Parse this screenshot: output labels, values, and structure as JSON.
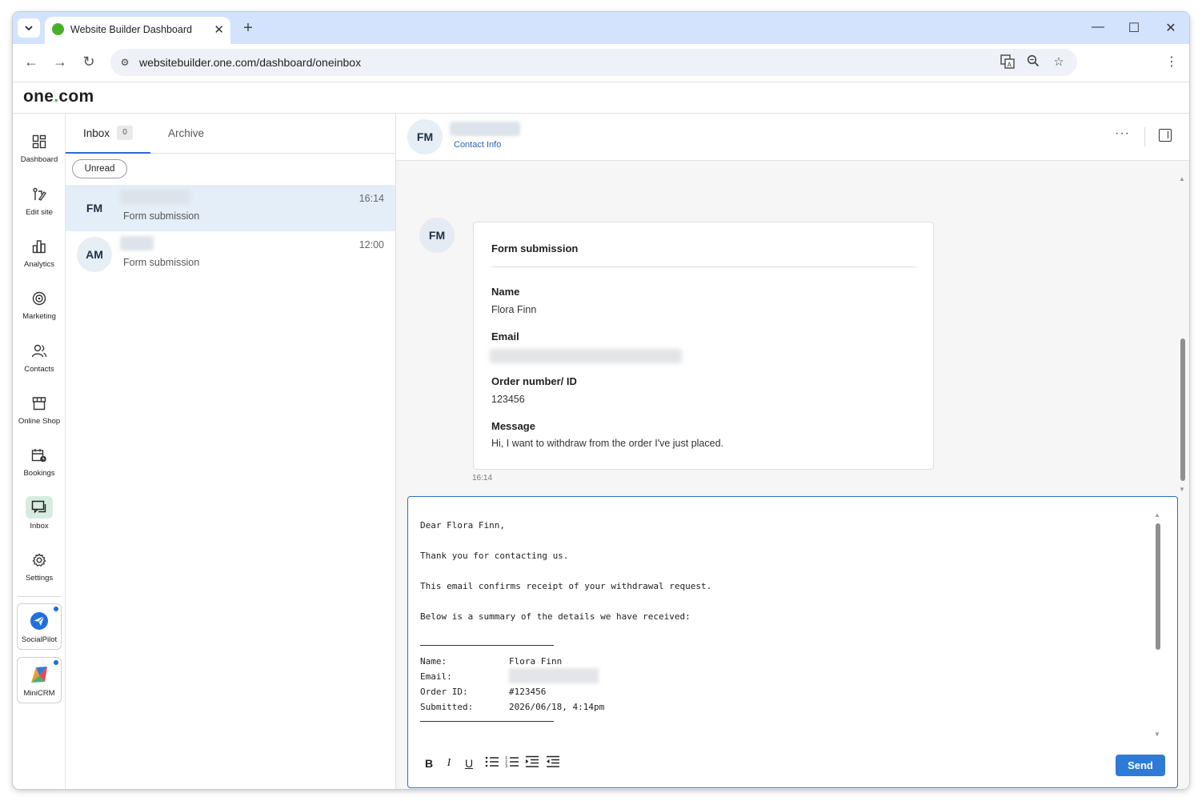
{
  "browser": {
    "tab_title": "Website Builder Dashboard",
    "url": "websitebuilder.one.com/dashboard/oneinbox"
  },
  "app": {
    "logo_text_a": "one",
    "logo_dot": ".",
    "logo_text_b": "com"
  },
  "nav": {
    "items": [
      {
        "label": "Dashboard",
        "icon": "dashboard-icon"
      },
      {
        "label": "Edit site",
        "icon": "edit-site-icon"
      },
      {
        "label": "Analytics",
        "icon": "analytics-icon"
      },
      {
        "label": "Marketing",
        "icon": "marketing-icon"
      },
      {
        "label": "Contacts",
        "icon": "contacts-icon"
      },
      {
        "label": "Online Shop",
        "icon": "shop-icon"
      },
      {
        "label": "Bookings",
        "icon": "bookings-icon"
      },
      {
        "label": "Inbox",
        "icon": "inbox-icon"
      },
      {
        "label": "Settings",
        "icon": "settings-icon"
      }
    ],
    "apps": [
      {
        "label": "SocialPilot",
        "icon": "socialpilot-icon"
      },
      {
        "label": "MiniCRM",
        "icon": "minicrm-icon"
      }
    ]
  },
  "inbox": {
    "tab_inbox": "Inbox",
    "inbox_count": "0",
    "tab_archive": "Archive",
    "filter_unread": "Unread",
    "conversations": [
      {
        "initials": "FM",
        "time": "16:14",
        "subject": "Form submission"
      },
      {
        "initials": "AM",
        "time": "12:00",
        "subject": "Form submission"
      }
    ]
  },
  "thread": {
    "initials": "FM",
    "contact_info": "Contact Info",
    "more": "···",
    "message": {
      "initials": "FM",
      "title": "Form submission",
      "name_label": "Name",
      "name_value": "Flora Finn",
      "email_label": "Email",
      "order_label": "Order number/ ID",
      "order_value": "123456",
      "message_label": "Message",
      "message_value": "Hi, I want to withdraw from the order I've just placed.",
      "time": "16:14"
    }
  },
  "composer": {
    "lines": [
      "Dear Flora Finn,",
      "Thank you for contacting us.",
      "This email confirms receipt of your withdrawal request.",
      "Below is a summary of the details we have received:"
    ],
    "summary_name_label": "Name:",
    "summary_name_value": "Flora Finn",
    "summary_email_label": "Email:",
    "summary_order_label": "Order ID:",
    "summary_order_value": "#123456",
    "summary_submitted_label": "Submitted:",
    "summary_submitted_value": "2026/06/18, 4:14pm",
    "send_label": "Send"
  }
}
